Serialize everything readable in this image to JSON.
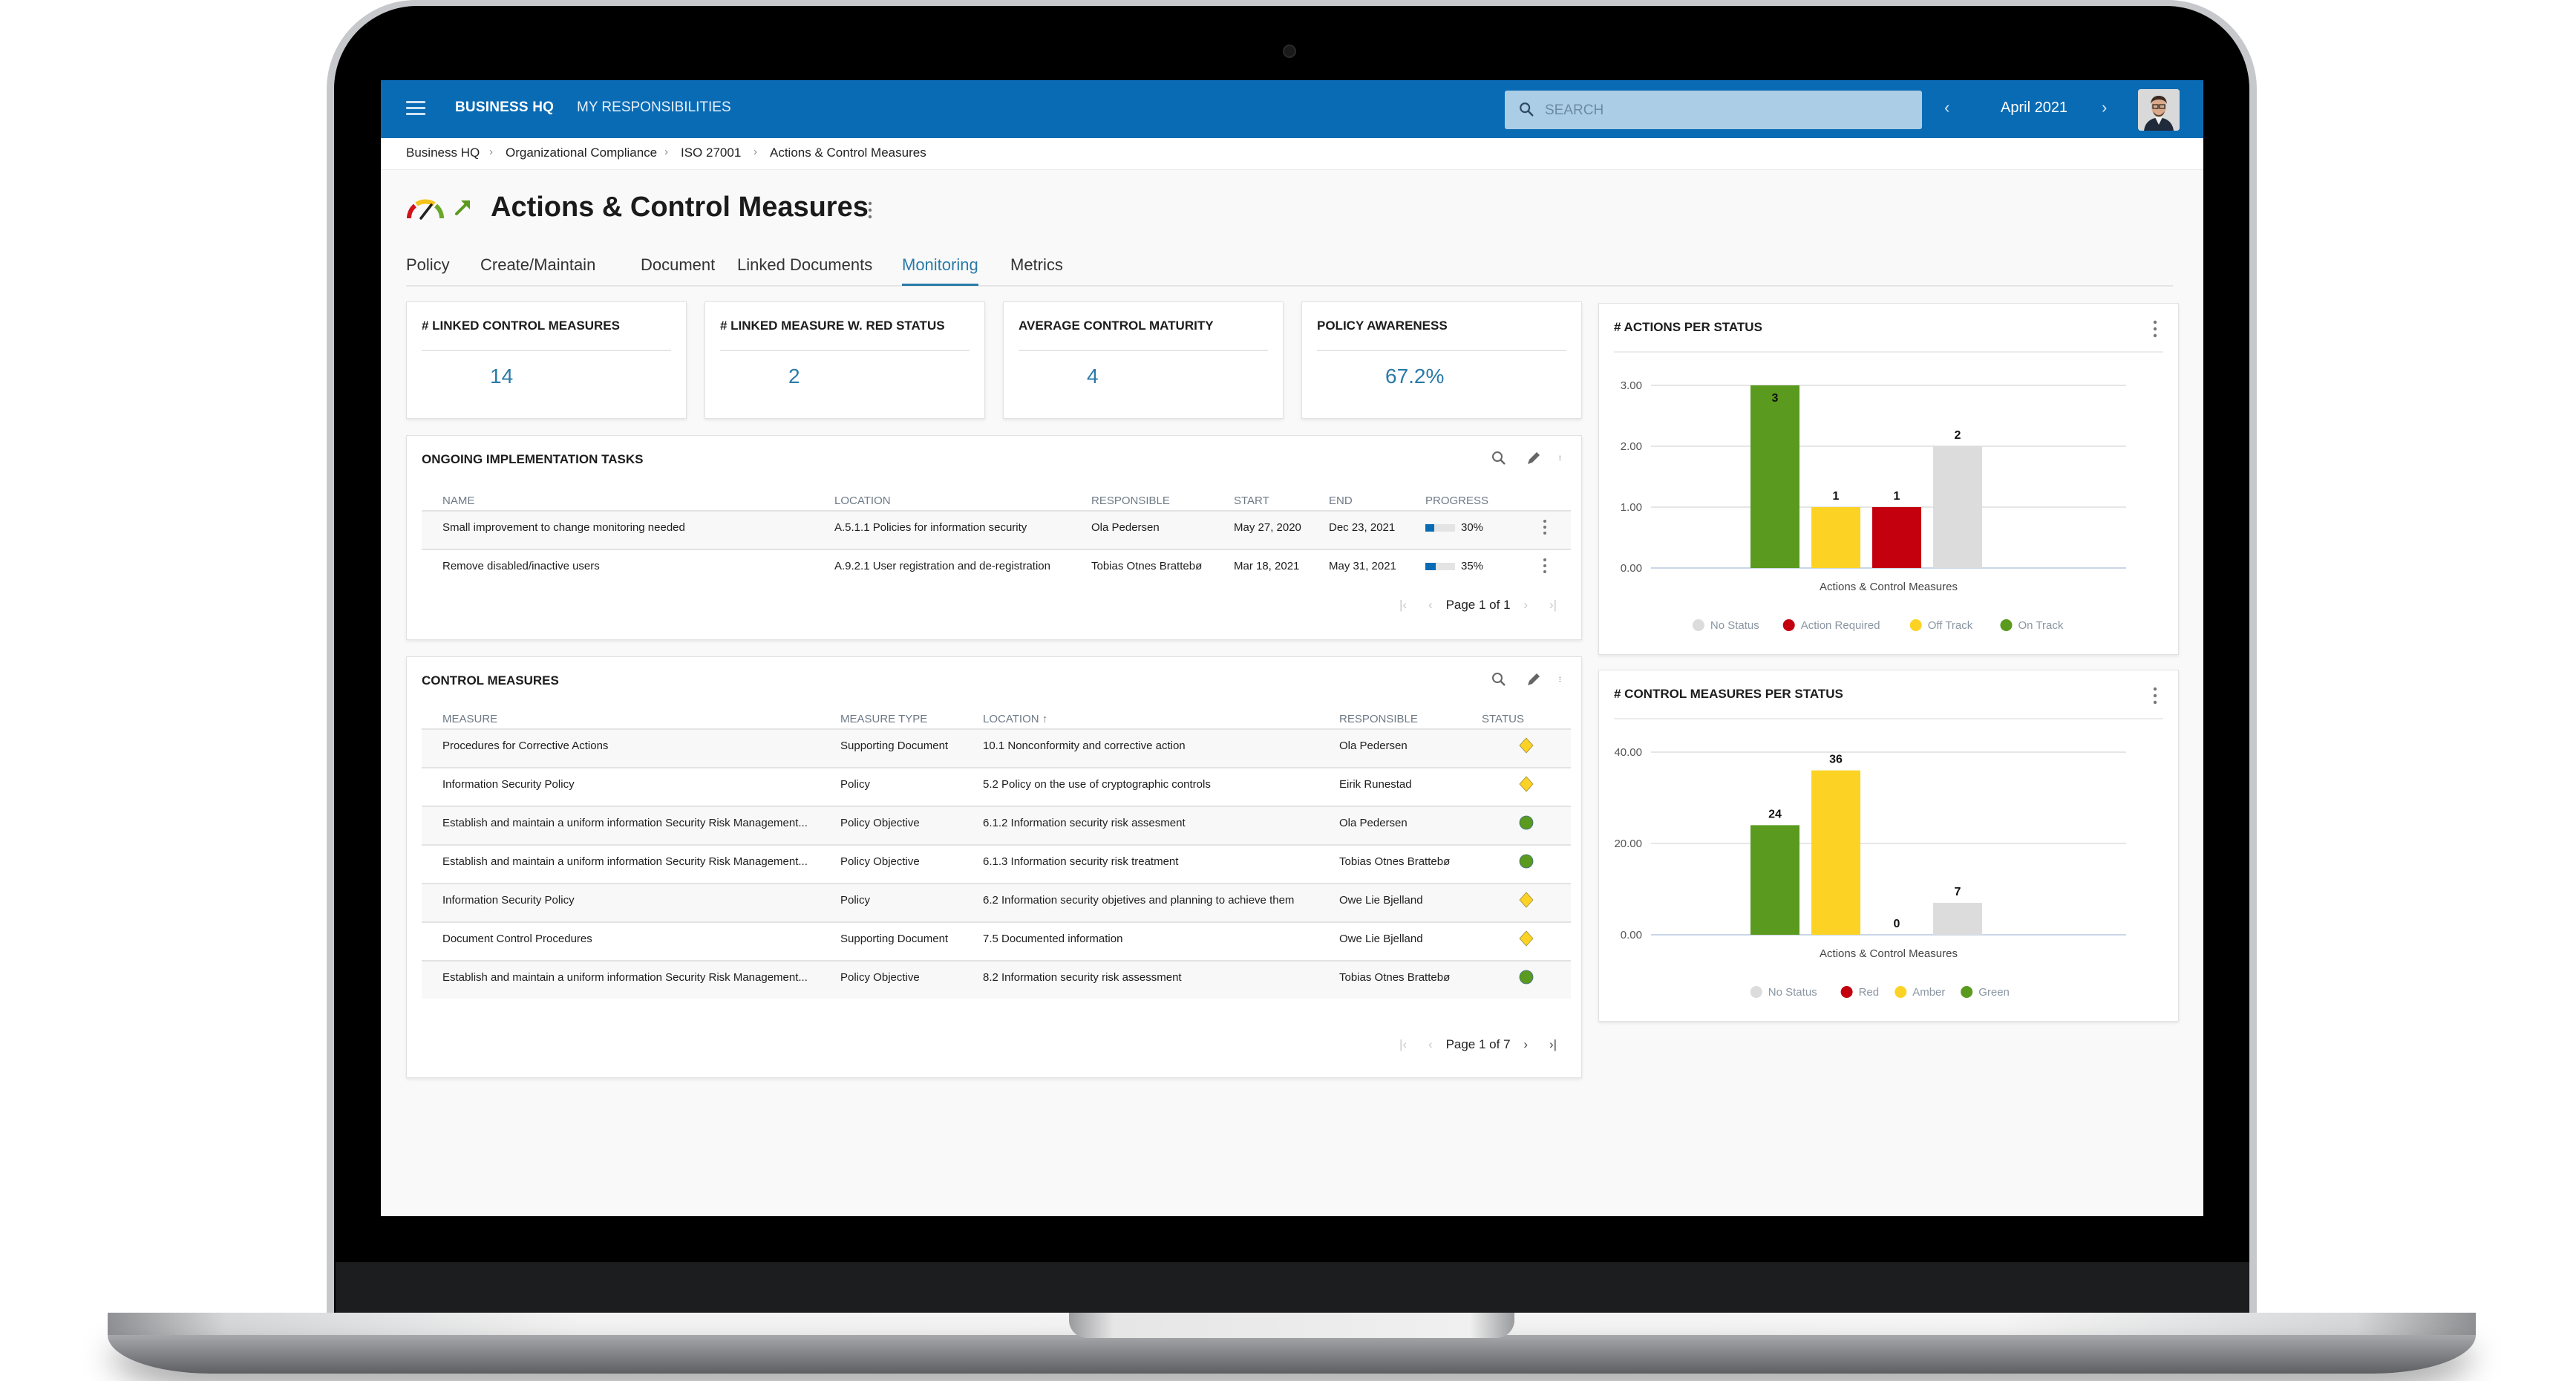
{
  "topbar": {
    "brand": "BUSINESS HQ",
    "nav_item": "MY RESPONSIBILITIES",
    "search_placeholder": "SEARCH",
    "period": "April 2021",
    "prev_label": "‹",
    "next_label": "›",
    "brand_color": "#0a6bb5"
  },
  "breadcrumb": [
    "Business HQ",
    "Organizational Compliance",
    "ISO 27001",
    "Actions & Control Measures"
  ],
  "breadcrumb_sep": "›",
  "page": {
    "title": "Actions & Control Measures",
    "status_icon": "gauge-icon",
    "trend_icon": "trend-up-arrow-icon"
  },
  "tabs": [
    {
      "label": "Policy",
      "active": false
    },
    {
      "label": "Create/Maintain",
      "active": false
    },
    {
      "label": "Document",
      "active": false
    },
    {
      "label": "Linked Documents",
      "active": false
    },
    {
      "label": "Monitoring",
      "active": true
    },
    {
      "label": "Metrics",
      "active": false
    }
  ],
  "kpis": [
    {
      "title": "# LINKED CONTROL MEASURES",
      "value": "14"
    },
    {
      "title": "# LINKED MEASURE W. RED STATUS",
      "value": "2"
    },
    {
      "title": "AVERAGE CONTROL MATURITY",
      "value": "4"
    },
    {
      "title": "POLICY AWARENESS",
      "value": "67.2%"
    }
  ],
  "tasks": {
    "title": "ONGOING IMPLEMENTATION TASKS",
    "columns": [
      "NAME",
      "LOCATION",
      "RESPONSIBLE",
      "START",
      "END",
      "PROGRESS"
    ],
    "rows": [
      {
        "name": "Small improvement to change monitoring needed",
        "location": "A.5.1.1 Policies for information security",
        "responsible": "Ola Pedersen",
        "start": "May 27, 2020",
        "end": "Dec 23, 2021",
        "progress": 30,
        "progress_label": "30%"
      },
      {
        "name": "Remove disabled/inactive users",
        "location": "A.9.2.1 User registration and de-registration",
        "responsible": "Tobias Otnes Brattebø",
        "start": "Mar 18, 2021",
        "end": "May 31, 2021",
        "progress": 35,
        "progress_label": "35%"
      }
    ],
    "pager": "Page 1 of 1"
  },
  "measures": {
    "title": "CONTROL MEASURES",
    "columns": [
      "MEASURE",
      "MEASURE TYPE",
      "LOCATION ↑",
      "RESPONSIBLE",
      "STATUS"
    ],
    "rows": [
      {
        "measure": "Procedures for Corrective Actions",
        "type": "Supporting Document",
        "location": "10.1 Nonconformity and corrective action",
        "responsible": "Ola Pedersen",
        "status": "amber"
      },
      {
        "measure": "Information Security Policy",
        "type": "Policy",
        "location": "5.2 Policy on the use of cryptographic controls",
        "responsible": "Eirik Runestad",
        "status": "amber"
      },
      {
        "measure": "Establish and maintain a uniform information Security Risk Management...",
        "type": "Policy Objective",
        "location": "6.1.2 Information security risk assesment",
        "responsible": "Ola Pedersen",
        "status": "green"
      },
      {
        "measure": "Establish and maintain a uniform information Security Risk Management...",
        "type": "Policy Objective",
        "location": "6.1.3 Information security risk treatment",
        "responsible": "Tobias Otnes Brattebø",
        "status": "green"
      },
      {
        "measure": "Information Security Policy",
        "type": "Policy",
        "location": "6.2 Information security objetives and planning to achieve them",
        "responsible": "Owe Lie Bjelland",
        "status": "amber"
      },
      {
        "measure": "Document Control Procedures",
        "type": "Supporting Document",
        "location": "7.5 Documented information",
        "responsible": "Owe Lie Bjelland",
        "status": "amber"
      },
      {
        "measure": "Establish and maintain a uniform information Security Risk Management...",
        "type": "Policy Objective",
        "location": "8.2 Information security risk assessment",
        "responsible": "Tobias Otnes Brattebø",
        "status": "green"
      }
    ],
    "pager": "Page 1 of 7"
  },
  "status_colors": {
    "green": "#5a9a1f",
    "amber": "#fcd325",
    "red": "#c4000f",
    "none": "#dcdcdc"
  },
  "chart_data": [
    {
      "type": "bar",
      "title": "# ACTIONS PER STATUS",
      "xlabel": "Actions & Control Measures",
      "ylabel": "",
      "categories": [
        "Actions & Control Measures"
      ],
      "series": [
        {
          "name": "On Track",
          "values": [
            3
          ],
          "color": "#5a9a1f"
        },
        {
          "name": "Off Track",
          "values": [
            1
          ],
          "color": "#fcd325"
        },
        {
          "name": "Action Required",
          "values": [
            1
          ],
          "color": "#c4000f"
        },
        {
          "name": "No Status",
          "values": [
            2
          ],
          "color": "#dcdcdc"
        }
      ],
      "data_labels": [
        "3",
        "1",
        "1",
        "2"
      ],
      "yticks": [
        "0.00",
        "1.00",
        "2.00",
        "3.00"
      ],
      "ylim": [
        0,
        3
      ],
      "grid": true,
      "legend": [
        "No Status",
        "Action Required",
        "Off Track",
        "On Track"
      ],
      "legend_colors": [
        "#dcdcdc",
        "#c4000f",
        "#fcd325",
        "#5a9a1f"
      ],
      "legend_position": "bottom"
    },
    {
      "type": "bar",
      "title": "# CONTROL MEASURES PER STATUS",
      "xlabel": "Actions & Control Measures",
      "ylabel": "",
      "categories": [
        "Actions & Control Measures"
      ],
      "series": [
        {
          "name": "Green",
          "values": [
            24
          ],
          "color": "#5a9a1f"
        },
        {
          "name": "Amber",
          "values": [
            36
          ],
          "color": "#fcd325"
        },
        {
          "name": "Red",
          "values": [
            0
          ],
          "color": "#c4000f"
        },
        {
          "name": "No Status",
          "values": [
            7
          ],
          "color": "#dcdcdc"
        }
      ],
      "data_labels": [
        "24",
        "36",
        "0",
        "7"
      ],
      "yticks": [
        "0.00",
        "20.00",
        "40.00"
      ],
      "ylim": [
        0,
        40
      ],
      "grid": true,
      "legend": [
        "No Status",
        "Red",
        "Amber",
        "Green"
      ],
      "legend_colors": [
        "#dcdcdc",
        "#c4000f",
        "#fcd325",
        "#5a9a1f"
      ],
      "legend_position": "bottom"
    }
  ]
}
